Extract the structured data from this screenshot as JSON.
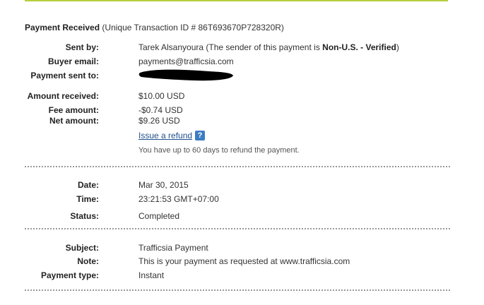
{
  "header": {
    "title": "Payment Received",
    "transaction": "(Unique Transaction ID # 86T693670P728320R)"
  },
  "sender": {
    "sent_by_label": "Sent by:",
    "sent_by_name": "Tarek Alsanyoura",
    "sent_by_note_prefix": "(The sender of this payment is ",
    "sent_by_status": "Non-U.S. - Verified",
    "sent_by_note_suffix": ")",
    "buyer_email_label": "Buyer email:",
    "buyer_email": "payments@trafficsia.com",
    "payment_sent_to_label": "Payment sent to:"
  },
  "amounts": {
    "amount_received_label": "Amount received:",
    "amount_received": "$10.00 USD",
    "fee_label": "Fee amount:",
    "fee": "-$0.74 USD",
    "net_label": "Net amount:",
    "net": "$9.26 USD",
    "refund_link": "Issue a refund",
    "help_icon": "?",
    "refund_note": "You have up to 60 days to refund the payment."
  },
  "details": {
    "date_label": "Date:",
    "date": "Mar 30, 2015",
    "time_label": "Time:",
    "time": "23:21:53 GMT+07:00",
    "status_label": "Status:",
    "status": "Completed"
  },
  "info": {
    "subject_label": "Subject:",
    "subject": "Trafficsia Payment",
    "note_label": "Note:",
    "note": "This is your payment as requested at www.trafficsia.com",
    "payment_type_label": "Payment type:",
    "payment_type": "Instant"
  },
  "colors": {
    "top_rule": "#b7cf3e",
    "link": "#1f4f8f",
    "help_icon": "#3c7dc4",
    "redaction": "#000000"
  }
}
